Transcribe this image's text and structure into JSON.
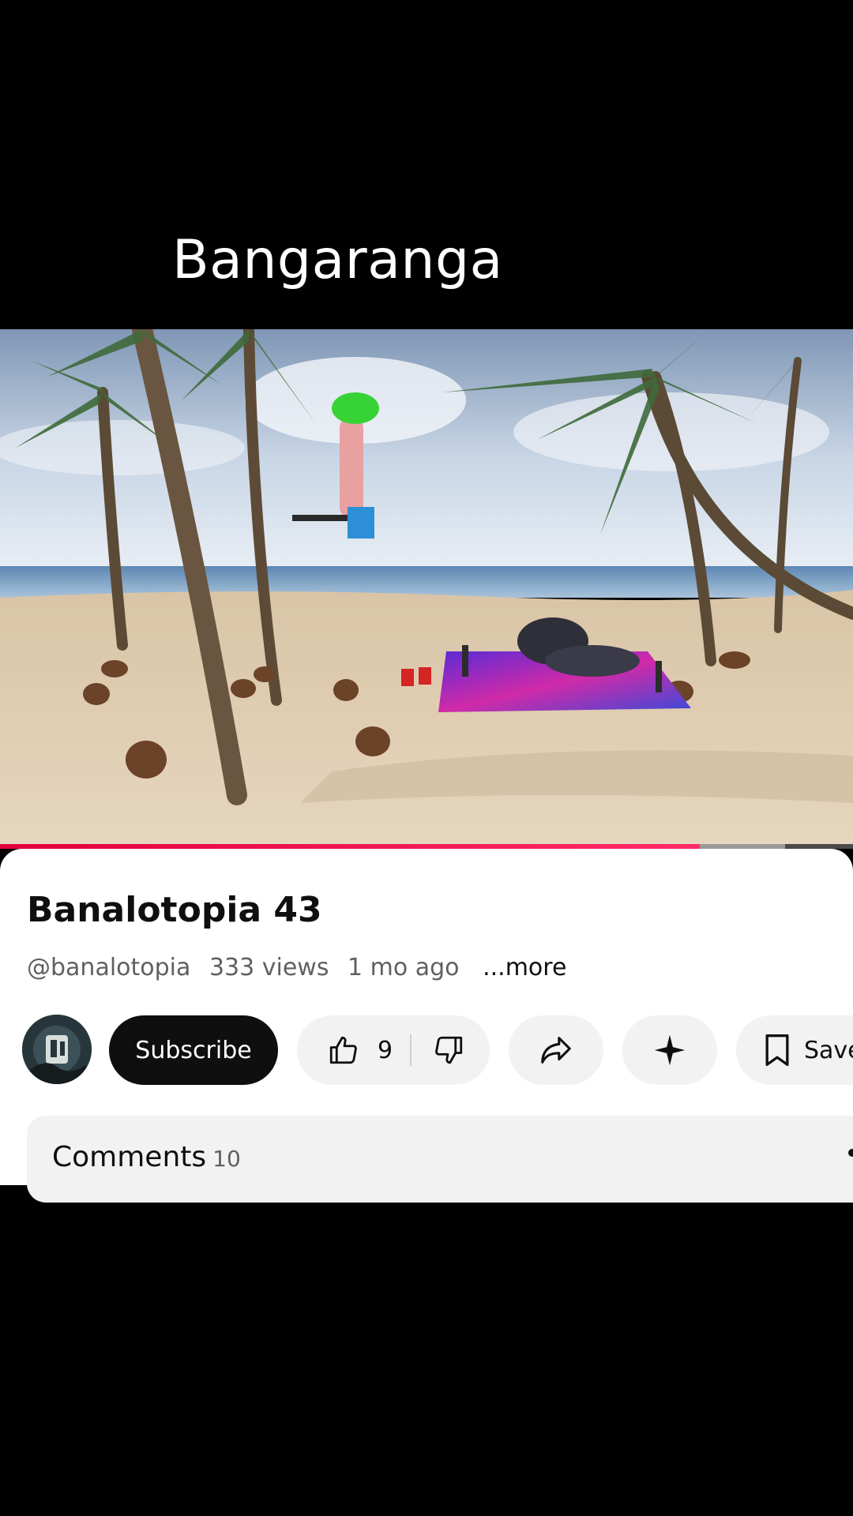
{
  "overlay": {
    "caption": "Bangaranga"
  },
  "player": {
    "progress_fraction": 0.82,
    "buffered_fraction": 0.92
  },
  "video": {
    "title": "Banalotopia 43",
    "channel": "@banalotopia",
    "views": "333 views",
    "age": "1 mo ago",
    "more_label": "...more"
  },
  "actions": {
    "subscribe_label": "Subscribe",
    "like_count": "9",
    "save_label": "Save"
  },
  "comments": {
    "label": "Comments",
    "count": "10"
  },
  "icons": {
    "like": "thumbs-up-icon",
    "dislike": "thumbs-down-icon",
    "share": "share-icon",
    "remix": "sparkle-icon",
    "save": "bookmark-icon"
  },
  "colors": {
    "progress": "#ff0040",
    "subscribe_bg": "#0f0f0f",
    "pill_bg": "#f2f2f2"
  }
}
